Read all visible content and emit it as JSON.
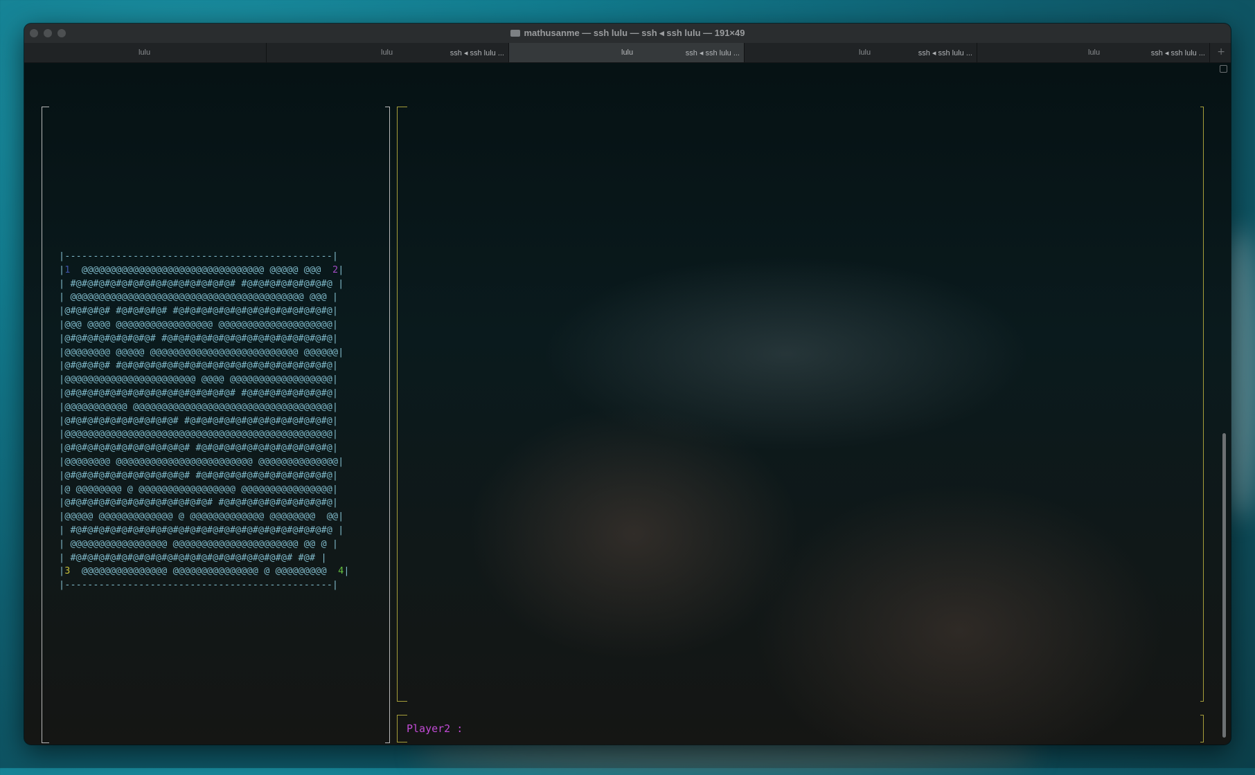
{
  "window": {
    "title": "mathusanme — ssh lulu — ssh ◂ ssh lulu — 191×49"
  },
  "tabs": [
    {
      "name": "lulu",
      "sub": ""
    },
    {
      "name": "lulu",
      "sub": "ssh ◂ ssh lulu ..."
    },
    {
      "name": "lulu",
      "sub": "ssh ◂ ssh lulu ...",
      "active": true
    },
    {
      "name": "lulu",
      "sub": "ssh ◂ ssh lulu ..."
    },
    {
      "name": "lulu",
      "sub": "ssh ◂ ssh lulu ..."
    }
  ],
  "new_tab_label": "+",
  "board": {
    "border": "|-----------------------------------------------|",
    "corner_labels": [
      "1",
      "2",
      "3",
      "4"
    ],
    "rows": [
      "|1  @@@@@@@@@@@@@@@@@@@@@@@@@@@@@@@@ @@@@@ @@@  2|",
      "| #@#@#@#@#@#@#@#@#@#@#@#@#@#@# #@#@#@#@#@#@#@#@ |",
      "| @@@@@@@@@@@@@@@@@@@@@@@@@@@@@@@@@@@@@@@@@ @@@ |",
      "|@#@#@#@# #@#@#@#@# #@#@#@#@#@#@#@#@#@#@#@#@#@#@|",
      "|@@@ @@@@ @@@@@@@@@@@@@@@@@ @@@@@@@@@@@@@@@@@@@@|",
      "|@#@#@#@#@#@#@#@# #@#@#@#@#@#@#@#@#@#@#@#@#@#@#@|",
      "|@@@@@@@@ @@@@@ @@@@@@@@@@@@@@@@@@@@@@@@@@ @@@@@@|",
      "|@#@#@#@# #@#@#@#@#@#@#@#@#@#@#@#@#@#@#@#@#@#@#@|",
      "|@@@@@@@@@@@@@@@@@@@@@@@ @@@@ @@@@@@@@@@@@@@@@@@|",
      "|@#@#@#@#@#@#@#@#@#@#@#@#@#@#@# #@#@#@#@#@#@#@#@|",
      "|@@@@@@@@@@@ @@@@@@@@@@@@@@@@@@@@@@@@@@@@@@@@@@@|",
      "|@#@#@#@#@#@#@#@#@#@# #@#@#@#@#@#@#@#@#@#@#@#@#@|",
      "|@@@@@@@@@@@@@@@@@@@@@@@@@@@@@@@@@@@@@@@@@@@@@@@|",
      "|@#@#@#@#@#@#@#@#@#@#@# #@#@#@#@#@#@#@#@#@#@#@#@|",
      "|@@@@@@@@ @@@@@@@@@@@@@@@@@@@@@@@@ @@@@@@@@@@@@@@|",
      "|@#@#@#@#@#@#@#@#@#@#@# #@#@#@#@#@#@#@#@#@#@#@#@|",
      "|@ @@@@@@@@ @ @@@@@@@@@@@@@@@@@ @@@@@@@@@@@@@@@@|",
      "|@#@#@#@#@#@#@#@#@#@#@#@#@# #@#@#@#@#@#@#@#@#@#@|",
      "|@@@@@ @@@@@@@@@@@@@ @ @@@@@@@@@@@@@ @@@@@@@@  @@|",
      "| #@#@#@#@#@#@#@#@#@#@#@#@#@#@#@#@#@#@#@#@#@#@#@ |",
      "| @@@@@@@@@@@@@@@@@ @@@@@@@@@@@@@@@@@@@@@@ @@ @ |",
      "| #@#@#@#@#@#@#@#@#@#@#@#@#@#@#@#@#@#@#@# #@# |",
      "|3  @@@@@@@@@@@@@@@ @@@@@@@@@@@@@@@ @ @@@@@@@@@  4|"
    ]
  },
  "prompt": {
    "label": "Player2 :"
  },
  "colors": {
    "corner1": "#3f54a8",
    "corner2": "#a34bc4",
    "corner3": "#c7c038",
    "corner4": "#64c040",
    "board": "#7fb9c9",
    "prompt": "#c24bd6",
    "frame_right": "#a8a03a"
  }
}
